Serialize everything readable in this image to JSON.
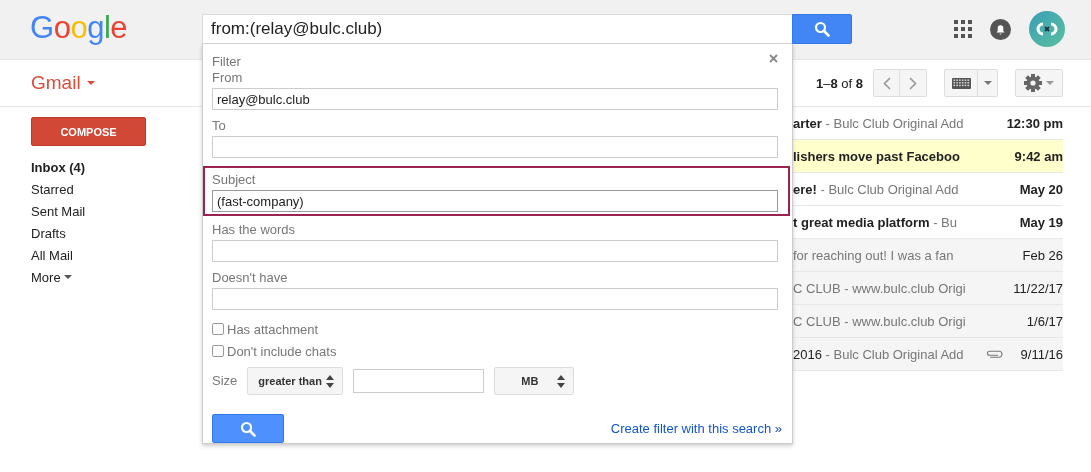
{
  "header": {
    "logo": "Google",
    "search": {
      "value": "from:(relay@bulc.club)"
    }
  },
  "toolbar": {
    "app_menu": "Gmail",
    "pagination": "**1**–**8** of **8**"
  },
  "sidebar": {
    "compose": "COMPOSE",
    "items": [
      {
        "label": "Inbox (4)",
        "selected": true,
        "has_menu": false
      },
      {
        "label": "Starred",
        "selected": false,
        "has_menu": false
      },
      {
        "label": "Sent Mail",
        "selected": false,
        "has_menu": false
      },
      {
        "label": "Drafts",
        "selected": false,
        "has_menu": false
      },
      {
        "label": "All Mail",
        "selected": false,
        "has_menu": false
      },
      {
        "label": "More",
        "selected": false,
        "has_menu": true
      }
    ]
  },
  "messages": [
    {
      "subject": "arter",
      "snippet": "- Bulc Club Original Add",
      "date": "12:30 pm",
      "unread": true,
      "highlighted": false,
      "attachment": false
    },
    {
      "subject": "lishers move past Faceboo",
      "date": "9:42 am",
      "unread": true,
      "highlighted": true,
      "attachment": false
    },
    {
      "subject": "ere!",
      "snippet": "- Bulc Club Original Add",
      "date": "May 20",
      "unread": true,
      "highlighted": false,
      "attachment": false
    },
    {
      "subject": "t great media platform",
      "snippet": "- Bu",
      "date": "May 19",
      "unread": true,
      "highlighted": false,
      "attachment": false
    },
    {
      "snippet": "for reaching out! I was a fan",
      "date": "Feb 26",
      "unread": false,
      "highlighted": false,
      "attachment": false
    },
    {
      "snippet": "C CLUB - www.bulc.club Origi",
      "date": "11/22/17",
      "unread": false,
      "highlighted": false,
      "attachment": false
    },
    {
      "snippet": "C CLUB - www.bulc.club Origi",
      "date": "1/6/17",
      "unread": false,
      "highlighted": false,
      "attachment": false
    },
    {
      "subject": "2016",
      "snippet": "- Bulc Club Original Add",
      "date": "9/11/16",
      "unread": false,
      "highlighted": false,
      "attachment": true
    }
  ],
  "filter": {
    "title": "Filter",
    "fields": [
      {
        "label": "From",
        "value": "relay@bulc.club",
        "focused": false
      },
      {
        "label": "To",
        "focused": false
      },
      {
        "label": "Subject",
        "value": "(fast-company)",
        "focused": true
      },
      {
        "label": "Has the words",
        "focused": false
      },
      {
        "label": "Doesn't have",
        "focused": false
      }
    ],
    "checkboxes": [
      {
        "label": "Has attachment",
        "checked": false
      },
      {
        "label": "Don't include chats",
        "checked": false
      }
    ],
    "size": {
      "label": "Size",
      "comparison": "greater than",
      "unit": "MB"
    },
    "create_link": "Create filter with this search »"
  }
}
